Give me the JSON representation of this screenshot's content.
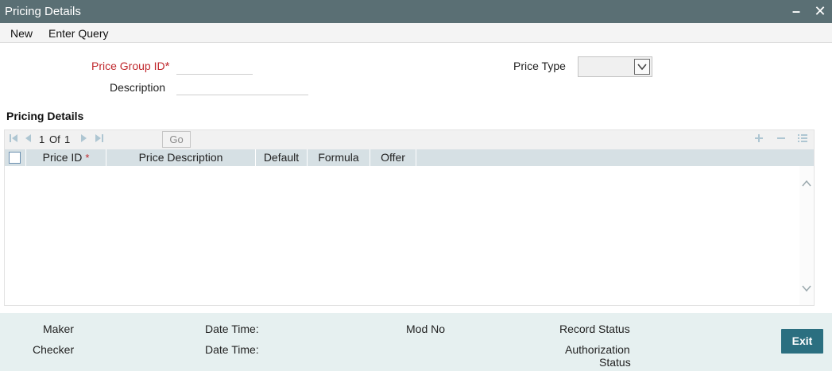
{
  "window": {
    "title": "Pricing Details",
    "minimize_glyph": "–",
    "close_glyph": "✕"
  },
  "menu": {
    "new_label": "New",
    "enter_query_label": "Enter Query"
  },
  "form": {
    "price_group_id_label": "Price Group ID",
    "required_marker": "*",
    "price_group_id_value": "",
    "description_label": "Description",
    "description_value": "",
    "price_type_label": "Price Type",
    "price_type_value": ""
  },
  "section": {
    "title": "Pricing Details"
  },
  "grid": {
    "page_current": "1",
    "page_of": "Of",
    "page_total": "1",
    "go_label": "Go",
    "columns": {
      "price_id": "Price ID",
      "price_description": "Price Description",
      "default": "Default",
      "formula": "Formula",
      "offer": "Offer"
    },
    "rows": []
  },
  "footer": {
    "maker_label": "Maker",
    "checker_label": "Checker",
    "date_time_label": "Date Time:",
    "date_time_label_2": "Date Time:",
    "mod_no_label": "Mod No",
    "record_status_label": "Record Status",
    "authorization_label": "Authorization",
    "status_label": "Status",
    "exit_label": "Exit"
  },
  "colors": {
    "titlebar": "#5a6f74",
    "required": "#c0282d",
    "grid_header": "#d6e0e4",
    "footer": "#e6f0f0",
    "exit_button": "#2b6f80"
  }
}
